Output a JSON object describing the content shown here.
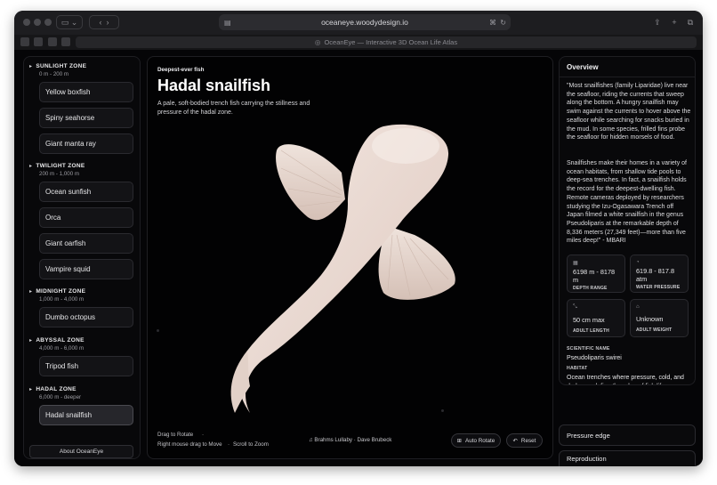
{
  "browser": {
    "url": "oceaneye.woodydesign.io",
    "tab_title": "OceanEye — Interactive 3D Ocean Life Atlas"
  },
  "sidebar": {
    "zones": [
      {
        "name": "SUNLIGHT ZONE",
        "depth": "0 m - 200 m",
        "fish": [
          "Yellow boxfish",
          "Spiny seahorse",
          "Giant manta ray"
        ]
      },
      {
        "name": "TWILIGHT ZONE",
        "depth": "200 m - 1,000 m",
        "fish": [
          "Ocean sunfish",
          "Orca",
          "Giant oarfish",
          "Vampire squid"
        ]
      },
      {
        "name": "MIDNIGHT ZONE",
        "depth": "1,000 m - 4,000 m",
        "fish": [
          "Dumbo octopus"
        ]
      },
      {
        "name": "ABYSSAL ZONE",
        "depth": "4,000 m - 6,000 m",
        "fish": [
          "Tripod fish"
        ]
      },
      {
        "name": "HADAL ZONE",
        "depth": "6,000 m - deeper",
        "fish": [
          "Hadal snailfish"
        ]
      }
    ],
    "about_label": "About OceanEye",
    "active_fish": "Hadal snailfish"
  },
  "viewer": {
    "eyebrow": "Deepest-ever fish",
    "title": "Hadal snailfish",
    "subtitle": "A pale, soft-bodied trench fish carrying the stillness and pressure of the hadal zone.",
    "hint_rotate": "Drag to Rotate",
    "hint_move": "Right mouse drag to Move",
    "hint_zoom": "Scroll to Zoom",
    "music": "Brahms Lullaby · Dave Brubeck",
    "auto_rotate_label": "Auto Rotate",
    "reset_label": "Reset"
  },
  "overview": {
    "title": "Overview",
    "paragraph1": "\"Most snailfishes (family Liparidae) live near the seafloor, riding the currents that sweep along the bottom. A hungry snailfish may swim against the currents to hover above the seafloor while searching for snacks buried in the mud. In some species, frilled fins probe the seafloor for hidden morsels of food.",
    "paragraph2": "Snailfishes make their homes in a variety of ocean habitats, from shallow tide pools to deep-sea trenches. In fact, a snailfish holds the record for the deepest-dwelling fish. Remote cameras deployed by researchers studying the Izu-Ogasawara Trench off Japan filmed a white snailfish in the genus Pseudoliparis at the remarkable depth of 8,336 meters (27,349 feet)—more than five miles deep!\" - MBARI",
    "stats": [
      {
        "value": "6198 m - 8178 m",
        "label": "DEPTH RANGE",
        "icon": "ruler-icon"
      },
      {
        "value": "619.8 - 817.8 atm",
        "label": "WATER PRESSURE",
        "icon": "gauge-icon"
      },
      {
        "value": "50 cm max",
        "label": "ADULT LENGTH",
        "icon": "length-icon"
      },
      {
        "value": "Unknown",
        "label": "ADULT WEIGHT",
        "icon": "weight-icon"
      }
    ],
    "scientific_name_label": "SCIENTIFIC NAME",
    "scientific_name": "Pseudoliparis swirei",
    "habitat_label": "HABITAT",
    "habitat": "Ocean trenches where pressure, cold, and darkness define the edge of fish life."
  },
  "accordions": [
    "Pressure edge",
    "Reproduction"
  ]
}
